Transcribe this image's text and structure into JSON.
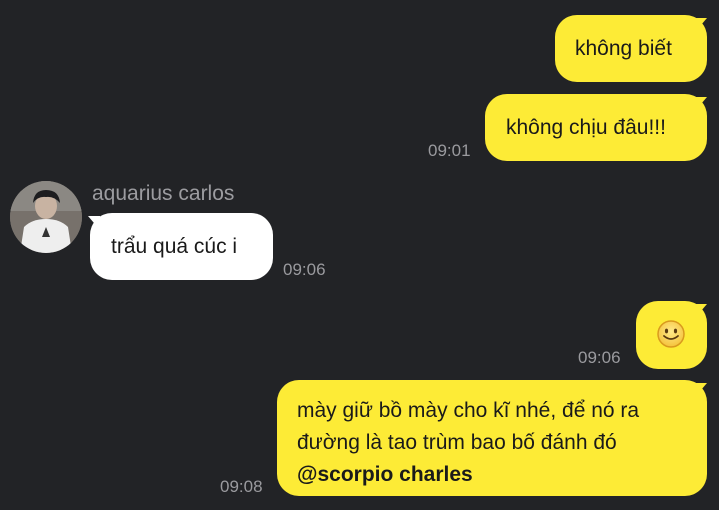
{
  "colors": {
    "background": "#222326",
    "outgoing_bubble": "#fdeb36",
    "incoming_bubble": "#ffffff",
    "timestamp": "#9a9a9e",
    "sender_name": "#9c9ca0"
  },
  "messages": {
    "m1": {
      "text": "không biết"
    },
    "m2": {
      "text": "không chịu đâu!!!",
      "time": "09:01"
    },
    "m3": {
      "sender": "aquarius carlos",
      "avatar_icon": "user-avatar",
      "text": "trẩu quá cúc i",
      "time": "09:06"
    },
    "m4": {
      "emoji_icon": "smiley-emoji-icon",
      "time": "09:06"
    },
    "m5": {
      "lines": [
        "mày giữ bồ mày cho kĩ nhé, để nó ra",
        "đường là tao trùm bao bố đánh đó"
      ],
      "mention": "@scorpio charles",
      "time": "09:08"
    }
  }
}
